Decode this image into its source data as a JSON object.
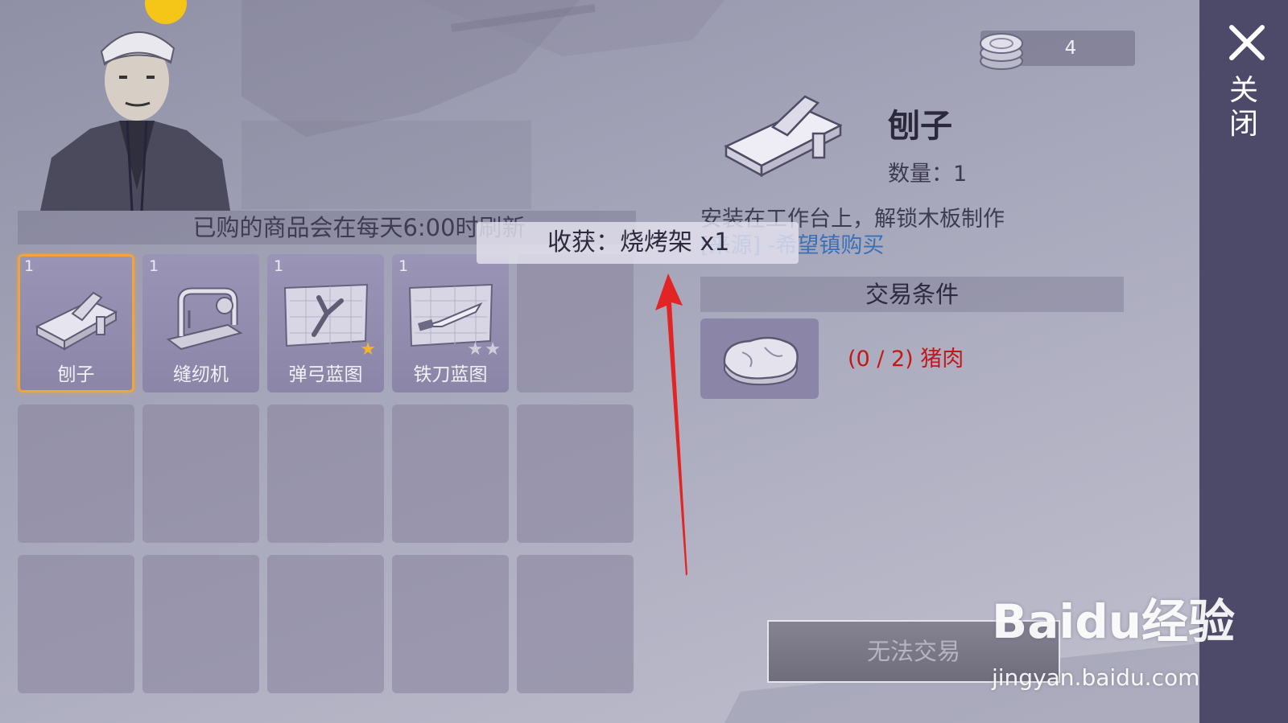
{
  "shop": {
    "refresh_notice": "已购的商品会在每天6:00时刷新",
    "slots": [
      {
        "count": "1",
        "label": "刨子",
        "icon": "planer-icon",
        "stars_gold": 0,
        "stars_grey": 0,
        "selected": true
      },
      {
        "count": "1",
        "label": "缝纫机",
        "icon": "sewing-machine-icon",
        "stars_gold": 0,
        "stars_grey": 0,
        "selected": false
      },
      {
        "count": "1",
        "label": "弹弓蓝图",
        "icon": "slingshot-blueprint-icon",
        "stars_gold": 1,
        "stars_grey": 0,
        "selected": false
      },
      {
        "count": "1",
        "label": "铁刀蓝图",
        "icon": "iron-knife-blueprint-icon",
        "stars_gold": 0,
        "stars_grey": 2,
        "selected": false
      }
    ],
    "total_slots": 15
  },
  "toast": {
    "harvest_text": "收获：烧烤架 x1"
  },
  "currency": {
    "value": "4",
    "icon": "coin-stack-icon"
  },
  "detail": {
    "name": "刨子",
    "quantity_label": "数量：",
    "quantity_value": "1",
    "description": "安装在工作台上，解锁木板制作",
    "source": "[来源] -希望镇购买"
  },
  "trade": {
    "header": "交易条件",
    "requirement_icon": "pork-icon",
    "requirement_text": "(0 / 2) 猪肉",
    "button_label": "无法交易"
  },
  "close": {
    "label": "关闭",
    "icon": "close-icon"
  },
  "watermark": {
    "logo_text": "Baidu经验",
    "url": "jingyan.baidu.com"
  },
  "colors": {
    "selected_border": "#f0a43a",
    "requirement_unmet": "#c21818",
    "source_link": "#2e6bb6",
    "close_panel": "#4c4a68"
  }
}
